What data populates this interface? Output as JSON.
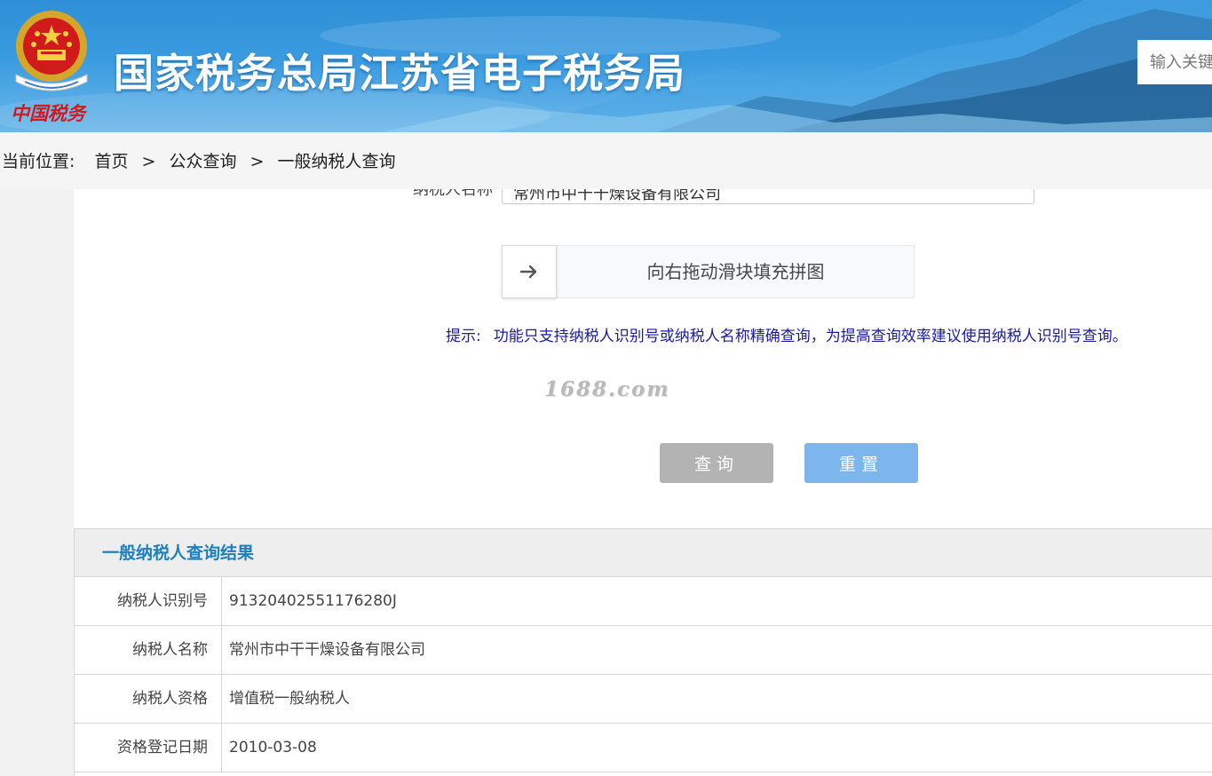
{
  "header": {
    "emblem_text": "中国税务",
    "site_title": "国家税务总局江苏省电子税务局",
    "search_placeholder": "输入关键字"
  },
  "breadcrumb": {
    "lead": "当前位置:",
    "items": [
      "首页",
      "公众查询",
      "一般纳税人查询"
    ],
    "separator": ">"
  },
  "form": {
    "taxpayer_name_label": "纳税人名称",
    "taxpayer_name_value": "常州市中干干燥设备有限公司",
    "slider_icon": "arrow-right-icon",
    "slider_text": "向右拖动滑块填充拼图",
    "tip_label": "提示:",
    "tip_text": "功能只支持纳税人识别号或纳税人名称精确查询，为提高查询效率建议使用纳税人识别号查询。",
    "watermark": "1688.com",
    "query_button": "查询",
    "reset_button": "重置"
  },
  "results": {
    "title": "一般纳税人查询结果",
    "rows": [
      {
        "label": "纳税人识别号",
        "value": "91320402551176280J"
      },
      {
        "label": "纳税人名称",
        "value": "常州市中干干燥设备有限公司"
      },
      {
        "label": "纳税人资格",
        "value": "增值税一般纳税人"
      },
      {
        "label": "资格登记日期",
        "value": "2010-03-08"
      }
    ]
  },
  "colors": {
    "header_blue": "#3a9be0",
    "results_title": "#1d80c2",
    "tip_text": "#1a1aa6",
    "query_button": "#b3b3b3",
    "reset_button": "#7cb6ec"
  }
}
